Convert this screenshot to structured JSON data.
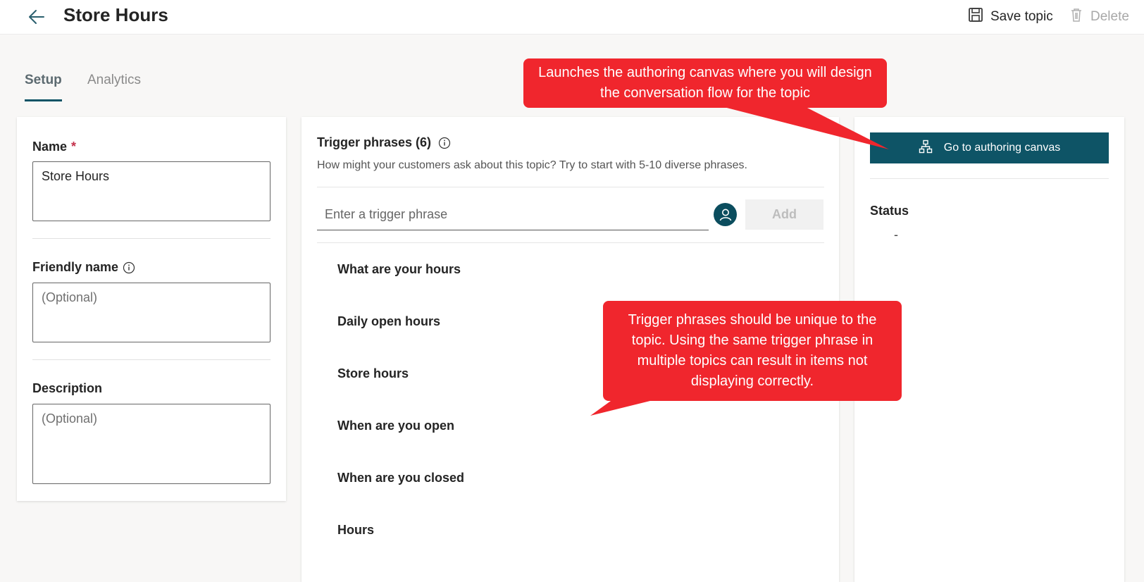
{
  "header": {
    "title": "Store Hours",
    "save_label": "Save topic",
    "delete_label": "Delete"
  },
  "tabs": [
    {
      "label": "Setup",
      "active": true
    },
    {
      "label": "Analytics",
      "active": false
    }
  ],
  "details": {
    "name_label": "Name",
    "name_required_mark": "*",
    "name_value": "Store Hours",
    "friendly_name_label": "Friendly name",
    "friendly_name_placeholder": "(Optional)",
    "description_label": "Description",
    "description_placeholder": "(Optional)"
  },
  "trigger_phrases": {
    "title": "Trigger phrases (6)",
    "description": "How might your customers ask about this topic? Try to start with 5-10 diverse phrases.",
    "input_placeholder": "Enter a trigger phrase",
    "add_label": "Add",
    "phrases": [
      "What are your hours",
      "Daily open hours",
      "Store hours",
      "When are you open",
      "When are you closed",
      "Hours"
    ]
  },
  "right_panel": {
    "canvas_button_label": "Go to authoring canvas",
    "status_label": "Status",
    "status_value": "-"
  },
  "callouts": {
    "canvas_note": "Launches the authoring canvas where you will design the conversation flow for the topic",
    "trigger_note": "Trigger phrases should be unique to the topic. Using the same trigger phrase in multiple topics can result in items not displaying correctly."
  },
  "colors": {
    "accent": "#0e5466",
    "callout": "#f0262d",
    "required": "#c4314b"
  }
}
